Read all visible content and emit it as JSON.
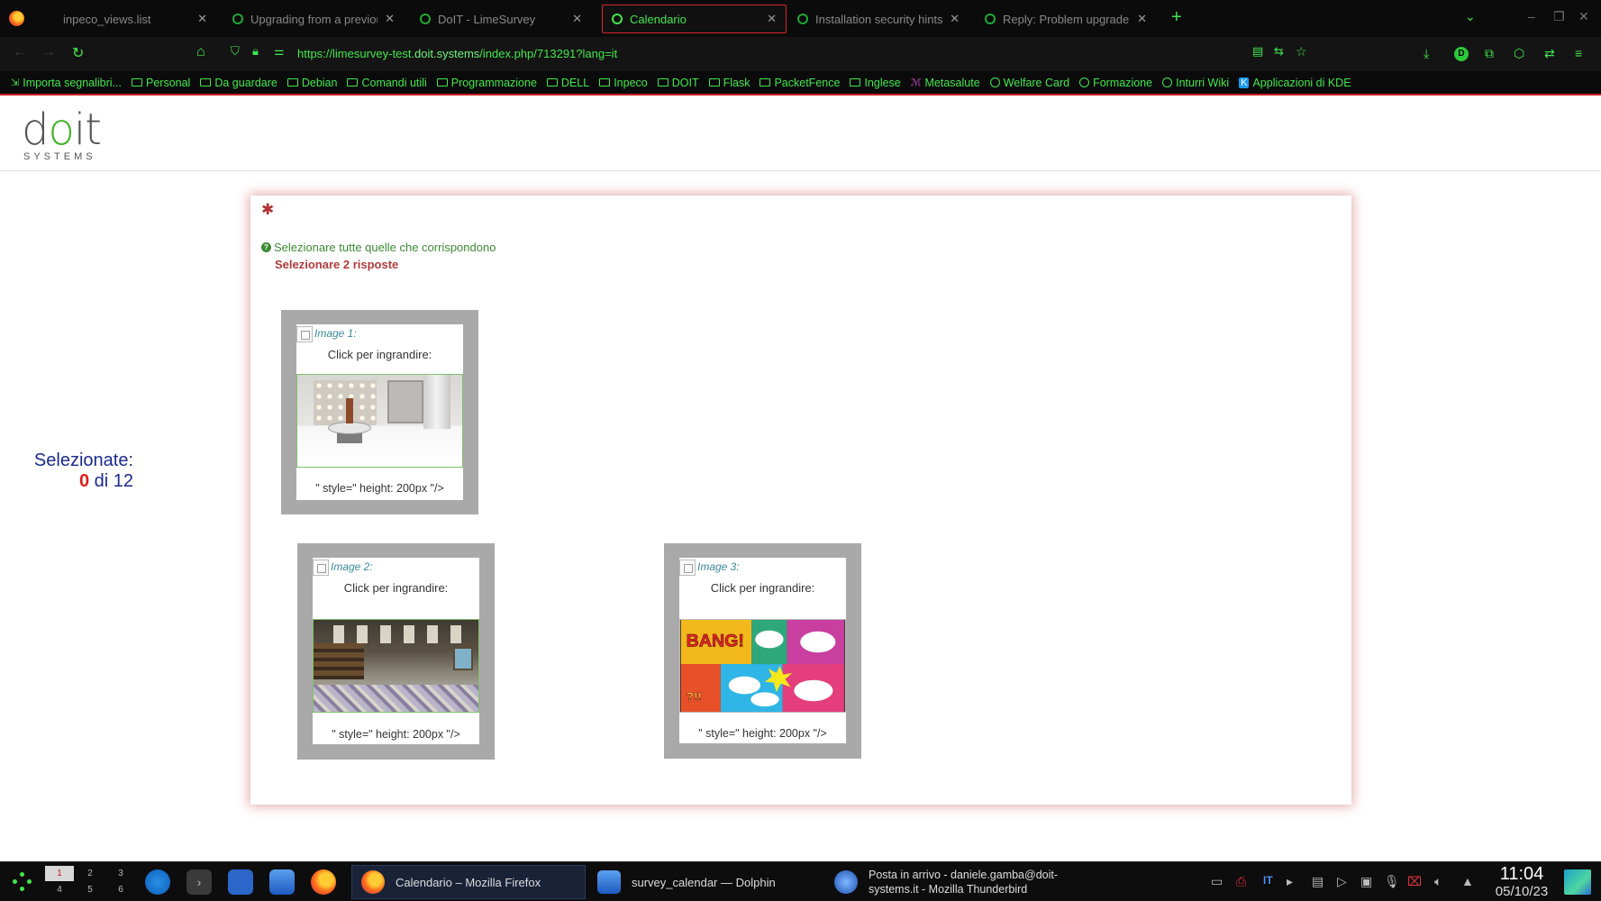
{
  "browser": {
    "tabs": [
      {
        "title": "inpeco_views.list",
        "close": "✕",
        "icon": "blank"
      },
      {
        "title": "Upgrading from a previou",
        "close": "✕",
        "icon": "limesurvey"
      },
      {
        "title": "DoIT - LimeSurvey",
        "close": "✕",
        "icon": "limesurvey"
      },
      {
        "title": "Calendario",
        "close": "✕",
        "icon": "limesurvey"
      },
      {
        "title": "Installation security hints",
        "close": "✕",
        "icon": "limesurvey"
      },
      {
        "title": "Reply: Problem upgrade -",
        "close": "✕",
        "icon": "limesurvey"
      }
    ],
    "new_tab": "+",
    "url_prefix": "https://limesurvey-test.",
    "url_domain": "doit.systems",
    "url_suffix": "/index.php/713291?lang=it",
    "profile_initial": "D",
    "bookmarks": [
      {
        "label": "Importa segnalibri...",
        "type": "import"
      },
      {
        "label": "Personal",
        "type": "folder"
      },
      {
        "label": "Da guardare",
        "type": "folder"
      },
      {
        "label": "Debian",
        "type": "folder"
      },
      {
        "label": "Comandi utili",
        "type": "folder"
      },
      {
        "label": "Programmazione",
        "type": "folder"
      },
      {
        "label": "DELL",
        "type": "folder"
      },
      {
        "label": "Inpeco",
        "type": "folder"
      },
      {
        "label": "DOIT",
        "type": "folder"
      },
      {
        "label": "Flask",
        "type": "folder"
      },
      {
        "label": "PacketFence",
        "type": "folder"
      },
      {
        "label": "Inglese",
        "type": "folder"
      },
      {
        "label": "Metasalute",
        "type": "link"
      },
      {
        "label": "Welfare Card",
        "type": "globe"
      },
      {
        "label": "Formazione",
        "type": "globe"
      },
      {
        "label": "Inturri Wiki",
        "type": "globe"
      },
      {
        "label": "Applicazioni di KDE",
        "type": "kde"
      }
    ]
  },
  "page": {
    "logo_word_pre": "d",
    "logo_word_o": "o",
    "logo_word_post": "it",
    "logo_sub": "SYSTEMS",
    "counter_label": "Selezionate:",
    "counter_value": "0",
    "counter_total": "di 12",
    "required_mark": "✱",
    "help_icon": "?",
    "help_text": "Selezionare tutte quelle che corrispondono",
    "tip_text": "Selezionare 2 risposte",
    "images": [
      {
        "caption": "Image 1:",
        "click_text": "Click per ingrandire:",
        "tail": "\" style=\" height: 200px \"/>",
        "art": "console"
      },
      {
        "caption": "Image 2:",
        "click_text": "Click per ingrandire:",
        "tail": "\" style=\" height: 200px \"/>",
        "art": "room"
      },
      {
        "caption": "Image 3:",
        "click_text": "Click per ingrandire:",
        "tail": "\" style=\" height: 200px \"/>",
        "art": "comic"
      }
    ]
  },
  "taskbar": {
    "pager": [
      "1",
      "2",
      "3",
      "4",
      "5",
      "6"
    ],
    "tasks": [
      {
        "label": "Calendario – Mozilla Firefox",
        "active": true
      },
      {
        "label": "survey_calendar — Dolphin",
        "active": false
      },
      {
        "label_line1": "Posta in arrivo - daniele.gamba@doit-",
        "label_line2": "systems.it - Mozilla Thunderbird",
        "active": false
      }
    ],
    "keyboard_layout": "IT",
    "time": "11:04",
    "date": "05/10/23"
  },
  "colors": {
    "accent_green": "#43e64d",
    "active_tab_border": "#d9232e",
    "counter_blue": "#1b2a8a",
    "counter_red": "#e01d1d",
    "help_green": "#3c8a33",
    "tip_red": "#b03a3a"
  }
}
